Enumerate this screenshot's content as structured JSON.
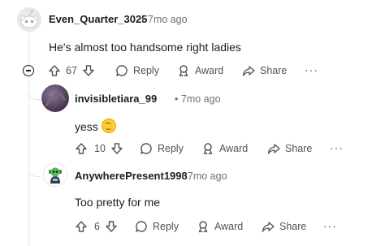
{
  "comments": [
    {
      "username": "Even_Quarter_3025",
      "time": "7mo ago",
      "text": "He's almost too handsome right ladies",
      "votes": "67"
    },
    {
      "username": "invisibletiara_99",
      "time": "7mo ago",
      "text": "yess",
      "votes": "10"
    },
    {
      "username": "AnywherePresent1998",
      "time": "7mo ago",
      "text": "Too pretty for me",
      "votes": "6"
    }
  ],
  "labels": {
    "separator": "•",
    "reply": "Reply",
    "award": "Award",
    "share": "Share",
    "more": "···"
  },
  "icons": {
    "upvote": "upvote-icon",
    "downvote": "downvote-icon",
    "reply": "speech-bubble-icon",
    "award": "award-icon",
    "share": "share-arrow-icon",
    "more": "ellipsis-icon",
    "collapse": "collapse-thread-icon",
    "emoji": "smiling-face-emoji-icon"
  },
  "colors": {
    "thread_line": "#e3e6e8",
    "text_muted": "#6b7075",
    "text": "#1c1c1c"
  }
}
